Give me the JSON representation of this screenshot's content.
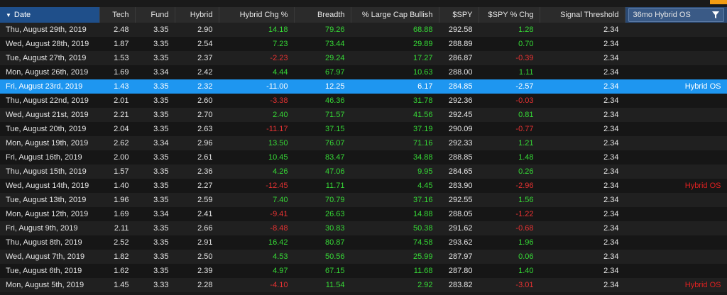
{
  "header": {
    "date": "Date",
    "tech": "Tech",
    "fund": "Fund",
    "hybrid": "Hybrid",
    "hybrid_chg": "Hybrid Chg %",
    "breadth": "Breadth",
    "lcb": "% Large Cap Bullish",
    "spy": "$SPY",
    "spy_chg": "$SPY % Chg",
    "threshold": "Signal Threshold",
    "os": "36mo Hybrid OS",
    "sort_icon": "sort-desc-icon",
    "filter_icon": "funnel-icon"
  },
  "colors": {
    "accent": "#f39c12",
    "selected": "#1e96f0",
    "positive": "#36d936",
    "negative": "#e63232"
  },
  "rows": [
    {
      "date": "Thu, August 29th, 2019",
      "tech": "2.48",
      "fund": "3.35",
      "hybrid": "2.90",
      "hchg": "14.18",
      "breadth": "79.26",
      "lcb": "68.88",
      "spy": "292.58",
      "spychg": "1.28",
      "thr": "2.34",
      "os": ""
    },
    {
      "date": "Wed, August 28th, 2019",
      "tech": "1.87",
      "fund": "3.35",
      "hybrid": "2.54",
      "hchg": "7.23",
      "breadth": "73.44",
      "lcb": "29.89",
      "spy": "288.89",
      "spychg": "0.70",
      "thr": "2.34",
      "os": ""
    },
    {
      "date": "Tue, August 27th, 2019",
      "tech": "1.53",
      "fund": "3.35",
      "hybrid": "2.37",
      "hchg": "-2.23",
      "breadth": "29.24",
      "lcb": "17.27",
      "spy": "286.87",
      "spychg": "-0.39",
      "thr": "2.34",
      "os": ""
    },
    {
      "date": "Mon, August 26th, 2019",
      "tech": "1.69",
      "fund": "3.34",
      "hybrid": "2.42",
      "hchg": "4.44",
      "breadth": "67.97",
      "lcb": "10.63",
      "spy": "288.00",
      "spychg": "1.11",
      "thr": "2.34",
      "os": ""
    },
    {
      "date": "Fri, August 23rd, 2019",
      "tech": "1.43",
      "fund": "3.35",
      "hybrid": "2.32",
      "hchg": "-11.00",
      "breadth": "12.25",
      "lcb": "6.17",
      "spy": "284.85",
      "spychg": "-2.57",
      "thr": "2.34",
      "os": "Hybrid OS",
      "selected": true
    },
    {
      "date": "Thu, August 22nd, 2019",
      "tech": "2.01",
      "fund": "3.35",
      "hybrid": "2.60",
      "hchg": "-3.38",
      "breadth": "46.36",
      "lcb": "31.78",
      "spy": "292.36",
      "spychg": "-0.03",
      "thr": "2.34",
      "os": ""
    },
    {
      "date": "Wed, August 21st, 2019",
      "tech": "2.21",
      "fund": "3.35",
      "hybrid": "2.70",
      "hchg": "2.40",
      "breadth": "71.57",
      "lcb": "41.56",
      "spy": "292.45",
      "spychg": "0.81",
      "thr": "2.34",
      "os": ""
    },
    {
      "date": "Tue, August 20th, 2019",
      "tech": "2.04",
      "fund": "3.35",
      "hybrid": "2.63",
      "hchg": "-11.17",
      "breadth": "37.15",
      "lcb": "37.19",
      "spy": "290.09",
      "spychg": "-0.77",
      "thr": "2.34",
      "os": ""
    },
    {
      "date": "Mon, August 19th, 2019",
      "tech": "2.62",
      "fund": "3.34",
      "hybrid": "2.96",
      "hchg": "13.50",
      "breadth": "76.07",
      "lcb": "71.16",
      "spy": "292.33",
      "spychg": "1.21",
      "thr": "2.34",
      "os": ""
    },
    {
      "date": "Fri, August 16th, 2019",
      "tech": "2.00",
      "fund": "3.35",
      "hybrid": "2.61",
      "hchg": "10.45",
      "breadth": "83.47",
      "lcb": "34.88",
      "spy": "288.85",
      "spychg": "1.48",
      "thr": "2.34",
      "os": ""
    },
    {
      "date": "Thu, August 15th, 2019",
      "tech": "1.57",
      "fund": "3.35",
      "hybrid": "2.36",
      "hchg": "4.26",
      "breadth": "47.06",
      "lcb": "9.95",
      "spy": "284.65",
      "spychg": "0.26",
      "thr": "2.34",
      "os": ""
    },
    {
      "date": "Wed, August 14th, 2019",
      "tech": "1.40",
      "fund": "3.35",
      "hybrid": "2.27",
      "hchg": "-12.45",
      "breadth": "11.71",
      "lcb": "4.45",
      "spy": "283.90",
      "spychg": "-2.96",
      "thr": "2.34",
      "os": "Hybrid OS"
    },
    {
      "date": "Tue, August 13th, 2019",
      "tech": "1.96",
      "fund": "3.35",
      "hybrid": "2.59",
      "hchg": "7.40",
      "breadth": "70.79",
      "lcb": "37.16",
      "spy": "292.55",
      "spychg": "1.56",
      "thr": "2.34",
      "os": ""
    },
    {
      "date": "Mon, August 12th, 2019",
      "tech": "1.69",
      "fund": "3.34",
      "hybrid": "2.41",
      "hchg": "-9.41",
      "breadth": "26.63",
      "lcb": "14.88",
      "spy": "288.05",
      "spychg": "-1.22",
      "thr": "2.34",
      "os": ""
    },
    {
      "date": "Fri, August 9th, 2019",
      "tech": "2.11",
      "fund": "3.35",
      "hybrid": "2.66",
      "hchg": "-8.48",
      "breadth": "30.83",
      "lcb": "50.38",
      "spy": "291.62",
      "spychg": "-0.68",
      "thr": "2.34",
      "os": ""
    },
    {
      "date": "Thu, August 8th, 2019",
      "tech": "2.52",
      "tech_note": "",
      "fund": "3.35",
      "hybrid": "2.91",
      "hchg": "16.42",
      "breadth": "80.87",
      "lcb": "74.58",
      "spy": "293.62",
      "spychg": "1.96",
      "thr": "2.34",
      "os": ""
    },
    {
      "date": "Wed, August 7th, 2019",
      "tech": "1.82",
      "fund": "3.35",
      "hybrid": "2.50",
      "hchg": "4.53",
      "breadth": "50.56",
      "lcb": "25.99",
      "spy": "287.97",
      "spychg": "0.06",
      "thr": "2.34",
      "os": ""
    },
    {
      "date": "Tue, August 6th, 2019",
      "tech": "1.62",
      "fund": "3.35",
      "hybrid": "2.39",
      "hchg": "4.97",
      "breadth": "67.15",
      "lcb": "11.68",
      "spy": "287.80",
      "spychg": "1.40",
      "thr": "2.34",
      "os": ""
    },
    {
      "date": "Mon, August 5th, 2019",
      "tech": "1.45",
      "fund": "3.33",
      "hybrid": "2.28",
      "hchg": "-4.10",
      "breadth": "11.54",
      "lcb": "2.92",
      "spy": "283.82",
      "spychg": "-3.01",
      "thr": "2.34",
      "os": "Hybrid OS"
    }
  ]
}
